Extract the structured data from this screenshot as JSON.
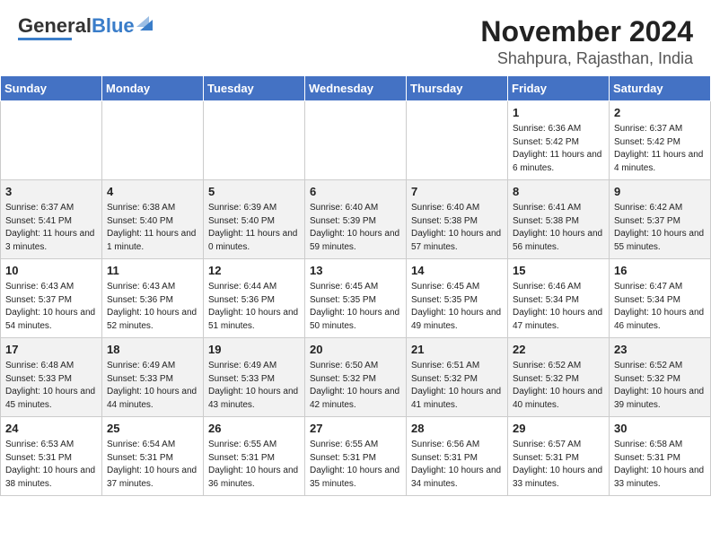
{
  "header": {
    "logo_general": "General",
    "logo_blue": "Blue",
    "main_title": "November 2024",
    "sub_title": "Shahpura, Rajasthan, India"
  },
  "days_of_week": [
    "Sunday",
    "Monday",
    "Tuesday",
    "Wednesday",
    "Thursday",
    "Friday",
    "Saturday"
  ],
  "weeks": [
    [
      {
        "day": "",
        "info": ""
      },
      {
        "day": "",
        "info": ""
      },
      {
        "day": "",
        "info": ""
      },
      {
        "day": "",
        "info": ""
      },
      {
        "day": "",
        "info": ""
      },
      {
        "day": "1",
        "info": "Sunrise: 6:36 AM\nSunset: 5:42 PM\nDaylight: 11 hours and 6 minutes."
      },
      {
        "day": "2",
        "info": "Sunrise: 6:37 AM\nSunset: 5:42 PM\nDaylight: 11 hours and 4 minutes."
      }
    ],
    [
      {
        "day": "3",
        "info": "Sunrise: 6:37 AM\nSunset: 5:41 PM\nDaylight: 11 hours and 3 minutes."
      },
      {
        "day": "4",
        "info": "Sunrise: 6:38 AM\nSunset: 5:40 PM\nDaylight: 11 hours and 1 minute."
      },
      {
        "day": "5",
        "info": "Sunrise: 6:39 AM\nSunset: 5:40 PM\nDaylight: 11 hours and 0 minutes."
      },
      {
        "day": "6",
        "info": "Sunrise: 6:40 AM\nSunset: 5:39 PM\nDaylight: 10 hours and 59 minutes."
      },
      {
        "day": "7",
        "info": "Sunrise: 6:40 AM\nSunset: 5:38 PM\nDaylight: 10 hours and 57 minutes."
      },
      {
        "day": "8",
        "info": "Sunrise: 6:41 AM\nSunset: 5:38 PM\nDaylight: 10 hours and 56 minutes."
      },
      {
        "day": "9",
        "info": "Sunrise: 6:42 AM\nSunset: 5:37 PM\nDaylight: 10 hours and 55 minutes."
      }
    ],
    [
      {
        "day": "10",
        "info": "Sunrise: 6:43 AM\nSunset: 5:37 PM\nDaylight: 10 hours and 54 minutes."
      },
      {
        "day": "11",
        "info": "Sunrise: 6:43 AM\nSunset: 5:36 PM\nDaylight: 10 hours and 52 minutes."
      },
      {
        "day": "12",
        "info": "Sunrise: 6:44 AM\nSunset: 5:36 PM\nDaylight: 10 hours and 51 minutes."
      },
      {
        "day": "13",
        "info": "Sunrise: 6:45 AM\nSunset: 5:35 PM\nDaylight: 10 hours and 50 minutes."
      },
      {
        "day": "14",
        "info": "Sunrise: 6:45 AM\nSunset: 5:35 PM\nDaylight: 10 hours and 49 minutes."
      },
      {
        "day": "15",
        "info": "Sunrise: 6:46 AM\nSunset: 5:34 PM\nDaylight: 10 hours and 47 minutes."
      },
      {
        "day": "16",
        "info": "Sunrise: 6:47 AM\nSunset: 5:34 PM\nDaylight: 10 hours and 46 minutes."
      }
    ],
    [
      {
        "day": "17",
        "info": "Sunrise: 6:48 AM\nSunset: 5:33 PM\nDaylight: 10 hours and 45 minutes."
      },
      {
        "day": "18",
        "info": "Sunrise: 6:49 AM\nSunset: 5:33 PM\nDaylight: 10 hours and 44 minutes."
      },
      {
        "day": "19",
        "info": "Sunrise: 6:49 AM\nSunset: 5:33 PM\nDaylight: 10 hours and 43 minutes."
      },
      {
        "day": "20",
        "info": "Sunrise: 6:50 AM\nSunset: 5:32 PM\nDaylight: 10 hours and 42 minutes."
      },
      {
        "day": "21",
        "info": "Sunrise: 6:51 AM\nSunset: 5:32 PM\nDaylight: 10 hours and 41 minutes."
      },
      {
        "day": "22",
        "info": "Sunrise: 6:52 AM\nSunset: 5:32 PM\nDaylight: 10 hours and 40 minutes."
      },
      {
        "day": "23",
        "info": "Sunrise: 6:52 AM\nSunset: 5:32 PM\nDaylight: 10 hours and 39 minutes."
      }
    ],
    [
      {
        "day": "24",
        "info": "Sunrise: 6:53 AM\nSunset: 5:31 PM\nDaylight: 10 hours and 38 minutes."
      },
      {
        "day": "25",
        "info": "Sunrise: 6:54 AM\nSunset: 5:31 PM\nDaylight: 10 hours and 37 minutes."
      },
      {
        "day": "26",
        "info": "Sunrise: 6:55 AM\nSunset: 5:31 PM\nDaylight: 10 hours and 36 minutes."
      },
      {
        "day": "27",
        "info": "Sunrise: 6:55 AM\nSunset: 5:31 PM\nDaylight: 10 hours and 35 minutes."
      },
      {
        "day": "28",
        "info": "Sunrise: 6:56 AM\nSunset: 5:31 PM\nDaylight: 10 hours and 34 minutes."
      },
      {
        "day": "29",
        "info": "Sunrise: 6:57 AM\nSunset: 5:31 PM\nDaylight: 10 hours and 33 minutes."
      },
      {
        "day": "30",
        "info": "Sunrise: 6:58 AM\nSunset: 5:31 PM\nDaylight: 10 hours and 33 minutes."
      }
    ]
  ]
}
